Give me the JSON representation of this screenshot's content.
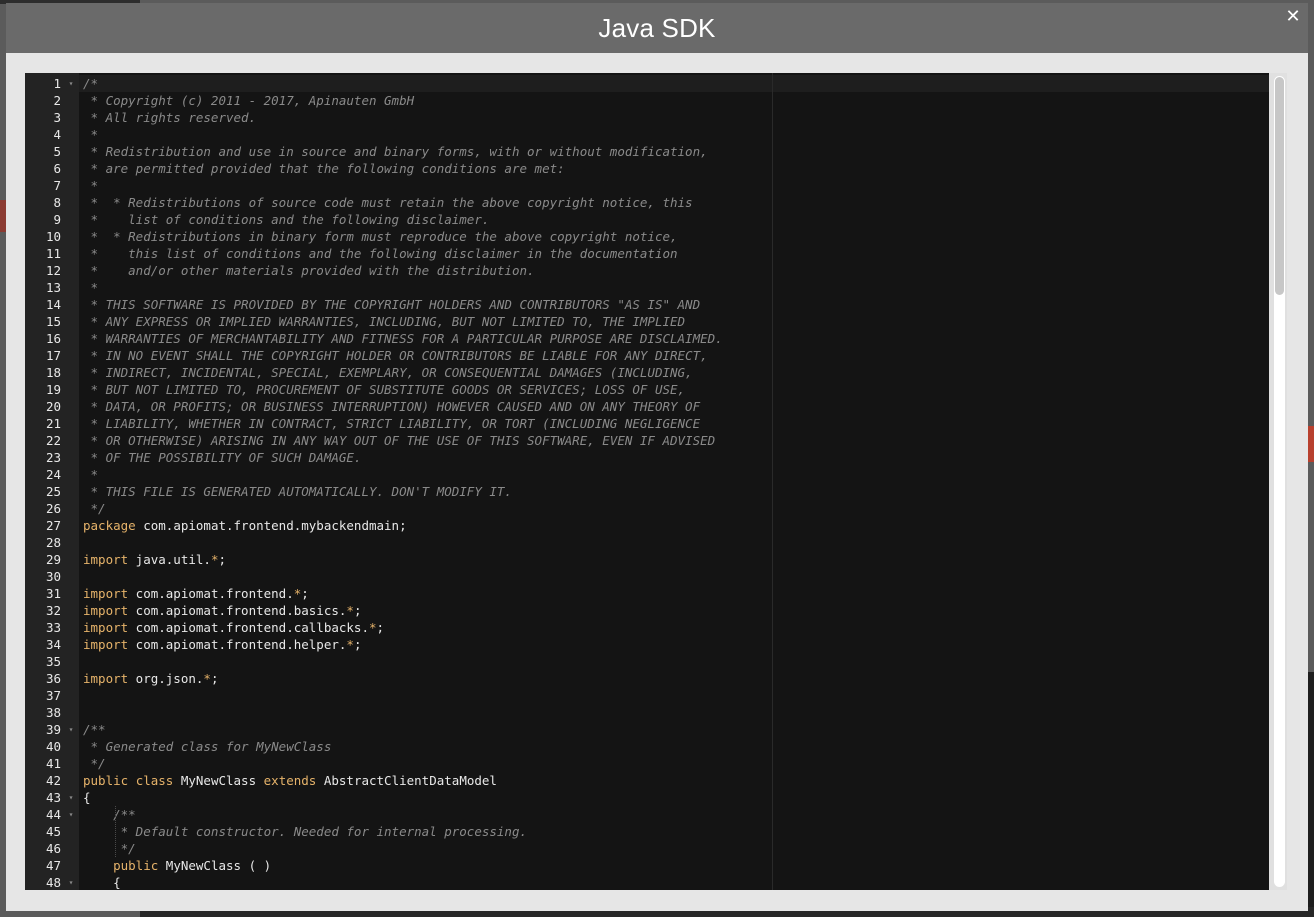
{
  "modal": {
    "title": "Java SDK",
    "close_label": "✕"
  },
  "editor": {
    "lines": [
      {
        "n": "1",
        "fold": true,
        "tokens": [
          {
            "t": "/*",
            "c": "comment"
          }
        ]
      },
      {
        "n": "2",
        "tokens": [
          {
            "t": " * Copyright (c) 2011 - 2017, Apinauten GmbH",
            "c": "comment"
          }
        ]
      },
      {
        "n": "3",
        "tokens": [
          {
            "t": " * All rights reserved.",
            "c": "comment"
          }
        ]
      },
      {
        "n": "4",
        "tokens": [
          {
            "t": " *",
            "c": "comment"
          }
        ]
      },
      {
        "n": "5",
        "tokens": [
          {
            "t": " * Redistribution and use in source and binary forms, with or without modification,",
            "c": "comment"
          }
        ]
      },
      {
        "n": "6",
        "tokens": [
          {
            "t": " * are permitted provided that the following conditions are met:",
            "c": "comment"
          }
        ]
      },
      {
        "n": "7",
        "tokens": [
          {
            "t": " *",
            "c": "comment"
          }
        ]
      },
      {
        "n": "8",
        "tokens": [
          {
            "t": " *  * Redistributions of source code must retain the above copyright notice, this",
            "c": "comment"
          }
        ]
      },
      {
        "n": "9",
        "tokens": [
          {
            "t": " *    list of conditions and the following disclaimer.",
            "c": "comment"
          }
        ]
      },
      {
        "n": "10",
        "tokens": [
          {
            "t": " *  * Redistributions in binary form must reproduce the above copyright notice,",
            "c": "comment"
          }
        ]
      },
      {
        "n": "11",
        "tokens": [
          {
            "t": " *    this list of conditions and the following disclaimer in the documentation",
            "c": "comment"
          }
        ]
      },
      {
        "n": "12",
        "tokens": [
          {
            "t": " *    and/or other materials provided with the distribution.",
            "c": "comment"
          }
        ]
      },
      {
        "n": "13",
        "tokens": [
          {
            "t": " *",
            "c": "comment"
          }
        ]
      },
      {
        "n": "14",
        "tokens": [
          {
            "t": " * THIS SOFTWARE IS PROVIDED BY THE COPYRIGHT HOLDERS AND CONTRIBUTORS \"AS IS\" AND",
            "c": "comment"
          }
        ]
      },
      {
        "n": "15",
        "tokens": [
          {
            "t": " * ANY EXPRESS OR IMPLIED WARRANTIES, INCLUDING, BUT NOT LIMITED TO, THE IMPLIED",
            "c": "comment"
          }
        ]
      },
      {
        "n": "16",
        "tokens": [
          {
            "t": " * WARRANTIES OF MERCHANTABILITY AND FITNESS FOR A PARTICULAR PURPOSE ARE DISCLAIMED.",
            "c": "comment"
          }
        ]
      },
      {
        "n": "17",
        "tokens": [
          {
            "t": " * IN NO EVENT SHALL THE COPYRIGHT HOLDER OR CONTRIBUTORS BE LIABLE FOR ANY DIRECT,",
            "c": "comment"
          }
        ]
      },
      {
        "n": "18",
        "tokens": [
          {
            "t": " * INDIRECT, INCIDENTAL, SPECIAL, EXEMPLARY, OR CONSEQUENTIAL DAMAGES (INCLUDING,",
            "c": "comment"
          }
        ]
      },
      {
        "n": "19",
        "tokens": [
          {
            "t": " * BUT NOT LIMITED TO, PROCUREMENT OF SUBSTITUTE GOODS OR SERVICES; LOSS OF USE,",
            "c": "comment"
          }
        ]
      },
      {
        "n": "20",
        "tokens": [
          {
            "t": " * DATA, OR PROFITS; OR BUSINESS INTERRUPTION) HOWEVER CAUSED AND ON ANY THEORY OF",
            "c": "comment"
          }
        ]
      },
      {
        "n": "21",
        "tokens": [
          {
            "t": " * LIABILITY, WHETHER IN CONTRACT, STRICT LIABILITY, OR TORT (INCLUDING NEGLIGENCE",
            "c": "comment"
          }
        ]
      },
      {
        "n": "22",
        "tokens": [
          {
            "t": " * OR OTHERWISE) ARISING IN ANY WAY OUT OF THE USE OF THIS SOFTWARE, EVEN IF ADVISED",
            "c": "comment"
          }
        ]
      },
      {
        "n": "23",
        "tokens": [
          {
            "t": " * OF THE POSSIBILITY OF SUCH DAMAGE.",
            "c": "comment"
          }
        ]
      },
      {
        "n": "24",
        "tokens": [
          {
            "t": " *",
            "c": "comment"
          }
        ]
      },
      {
        "n": "25",
        "tokens": [
          {
            "t": " * THIS FILE IS GENERATED AUTOMATICALLY. DON'T MODIFY IT.",
            "c": "comment"
          }
        ]
      },
      {
        "n": "26",
        "tokens": [
          {
            "t": " */",
            "c": "comment"
          }
        ]
      },
      {
        "n": "27",
        "tokens": [
          {
            "t": "package",
            "c": "keyword"
          },
          {
            "t": " com.apiomat.frontend.mybackendmain;",
            "c": "plain"
          }
        ]
      },
      {
        "n": "28",
        "tokens": []
      },
      {
        "n": "29",
        "tokens": [
          {
            "t": "import",
            "c": "keyword"
          },
          {
            "t": " java.util.",
            "c": "plain"
          },
          {
            "t": "*",
            "c": "op"
          },
          {
            "t": ";",
            "c": "plain"
          }
        ]
      },
      {
        "n": "30",
        "tokens": []
      },
      {
        "n": "31",
        "tokens": [
          {
            "t": "import",
            "c": "keyword"
          },
          {
            "t": " com.apiomat.frontend.",
            "c": "plain"
          },
          {
            "t": "*",
            "c": "op"
          },
          {
            "t": ";",
            "c": "plain"
          }
        ]
      },
      {
        "n": "32",
        "tokens": [
          {
            "t": "import",
            "c": "keyword"
          },
          {
            "t": " com.apiomat.frontend.basics.",
            "c": "plain"
          },
          {
            "t": "*",
            "c": "op"
          },
          {
            "t": ";",
            "c": "plain"
          }
        ]
      },
      {
        "n": "33",
        "tokens": [
          {
            "t": "import",
            "c": "keyword"
          },
          {
            "t": " com.apiomat.frontend.callbacks.",
            "c": "plain"
          },
          {
            "t": "*",
            "c": "op"
          },
          {
            "t": ";",
            "c": "plain"
          }
        ]
      },
      {
        "n": "34",
        "tokens": [
          {
            "t": "import",
            "c": "keyword"
          },
          {
            "t": " com.apiomat.frontend.helper.",
            "c": "plain"
          },
          {
            "t": "*",
            "c": "op"
          },
          {
            "t": ";",
            "c": "plain"
          }
        ]
      },
      {
        "n": "35",
        "tokens": []
      },
      {
        "n": "36",
        "tokens": [
          {
            "t": "import",
            "c": "keyword"
          },
          {
            "t": " org.json.",
            "c": "plain"
          },
          {
            "t": "*",
            "c": "op"
          },
          {
            "t": ";",
            "c": "plain"
          }
        ]
      },
      {
        "n": "37",
        "tokens": []
      },
      {
        "n": "38",
        "tokens": []
      },
      {
        "n": "39",
        "fold": true,
        "tokens": [
          {
            "t": "/**",
            "c": "comment"
          }
        ]
      },
      {
        "n": "40",
        "tokens": [
          {
            "t": " * Generated class for MyNewClass",
            "c": "comment"
          }
        ]
      },
      {
        "n": "41",
        "tokens": [
          {
            "t": " */",
            "c": "comment"
          }
        ]
      },
      {
        "n": "42",
        "tokens": [
          {
            "t": "public",
            "c": "keyword"
          },
          {
            "t": " ",
            "c": "plain"
          },
          {
            "t": "class",
            "c": "keyword"
          },
          {
            "t": " MyNewClass ",
            "c": "plain"
          },
          {
            "t": "extends",
            "c": "keyword"
          },
          {
            "t": " AbstractClientDataModel",
            "c": "plain"
          }
        ]
      },
      {
        "n": "43",
        "fold": true,
        "tokens": [
          {
            "t": "{",
            "c": "plain"
          }
        ]
      },
      {
        "n": "44",
        "fold": true,
        "tokens": [
          {
            "t": "    ",
            "c": "plain"
          },
          {
            "t": "/**",
            "c": "comment"
          }
        ]
      },
      {
        "n": "45",
        "tokens": [
          {
            "t": "     * Default constructor. Needed for internal processing.",
            "c": "comment"
          }
        ]
      },
      {
        "n": "46",
        "tokens": [
          {
            "t": "     */",
            "c": "comment"
          }
        ]
      },
      {
        "n": "47",
        "tokens": [
          {
            "t": "    ",
            "c": "plain"
          },
          {
            "t": "public",
            "c": "keyword"
          },
          {
            "t": " MyNewClass ( )",
            "c": "plain"
          }
        ]
      },
      {
        "n": "48",
        "fold": true,
        "tokens": [
          {
            "t": "    {",
            "c": "plain"
          }
        ]
      }
    ]
  },
  "icons": {
    "fold_marker": "▾"
  },
  "colors": {
    "comment": "#8a8a8a",
    "keyword": "#e6b36a",
    "plain": "#e8e8e8"
  }
}
